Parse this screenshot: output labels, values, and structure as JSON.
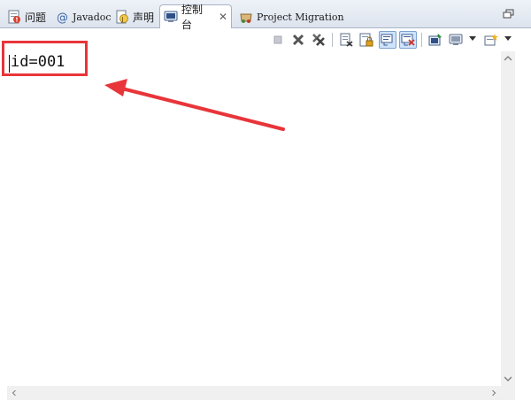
{
  "tabs": [
    {
      "label": "问题",
      "icon": "problems-icon",
      "active": false
    },
    {
      "label": "Javadoc",
      "icon": "javadoc-at-icon",
      "active": false
    },
    {
      "label": "声明",
      "icon": "declaration-icon",
      "active": false
    },
    {
      "label": "控制台",
      "icon": "console-icon",
      "active": true,
      "close": "✕"
    },
    {
      "label": "Project Migration",
      "icon": "project-migration-icon",
      "active": false
    }
  ],
  "toolbar": {
    "buttons": [
      "terminate-icon",
      "remove-launch-icon",
      "remove-all-terminated-icon",
      "clear-console-icon",
      "scroll-lock-icon",
      "word-wrap-icon",
      "show-on-stdout-icon",
      "show-on-stderr-icon",
      "pin-console-icon",
      "display-console-icon",
      "open-console-icon"
    ]
  },
  "console": {
    "output": "id=001"
  },
  "colors": {
    "annotation": "#e8353a",
    "tab_bar_bg": "#dde4ee",
    "active_button_bg": "#cfe3fb"
  }
}
